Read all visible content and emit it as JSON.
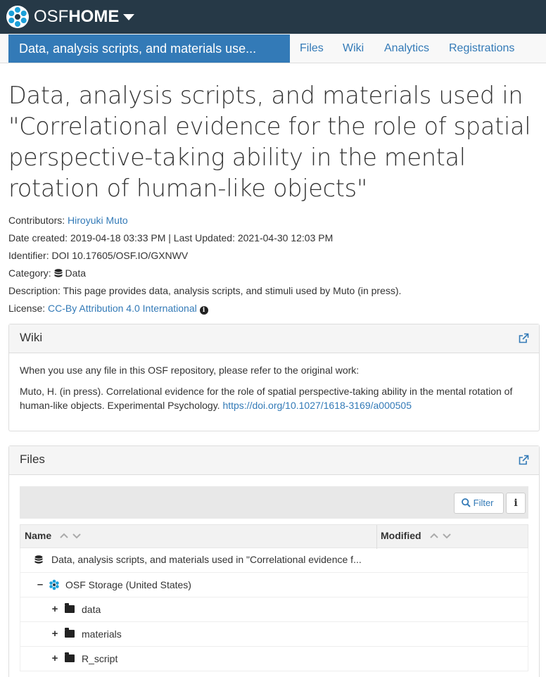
{
  "navbar": {
    "brand_light": "OSF",
    "brand_bold": "HOME",
    "logo_icon": "osf-logo-icon",
    "dropdown_icon": "caret-down-icon"
  },
  "project_nav": {
    "title": "Data, analysis scripts, and materials use...",
    "links": [
      "Files",
      "Wiki",
      "Analytics",
      "Registrations"
    ]
  },
  "project": {
    "title": "Data, analysis scripts, and materials used in \"Correlational evidence for the role of spatial perspective-taking ability in the mental rotation of human-like objects\"",
    "contributors_label": "Contributors:",
    "contributor": "Hiroyuki Muto",
    "dates": "Date created: 2019-04-18 03:33 PM | Last Updated: 2021-04-30 12:03 PM",
    "identifier": "Identifier: DOI 10.17605/OSF.IO/GXNWV",
    "category_label": "Category:",
    "category": "Data",
    "description": "Description: This page provides data, analysis scripts, and stimuli used by Muto (in press).",
    "license_label": "License:",
    "license": "CC-By Attribution 4.0 International"
  },
  "wiki": {
    "heading": "Wiki",
    "para1": "When you use any file in this OSF repository, please refer to the original work:",
    "para2": "Muto, H. (in press). Correlational evidence for the role of spatial perspective-taking ability in the mental rotation of human-like objects. Experimental Psychology.",
    "link": "https://doi.org/10.1027/1618-3169/a000505"
  },
  "files": {
    "heading": "Files",
    "filter_label": "Filter",
    "info_label": "i",
    "columns": {
      "name": "Name",
      "modified": "Modified"
    },
    "rows": [
      {
        "label": "Data, analysis scripts, and materials used in \"Correlational evidence f...",
        "icon": "database-icon",
        "toggle": ""
      },
      {
        "label": "OSF Storage (United States)",
        "icon": "osf-storage-icon",
        "toggle": "–"
      },
      {
        "label": "data",
        "icon": "folder-icon",
        "toggle": "+"
      },
      {
        "label": "materials",
        "icon": "folder-icon",
        "toggle": "+"
      },
      {
        "label": "R_script",
        "icon": "folder-icon",
        "toggle": "+"
      }
    ]
  },
  "colors": {
    "navbar_bg": "#263947",
    "accent": "#337ab7"
  }
}
